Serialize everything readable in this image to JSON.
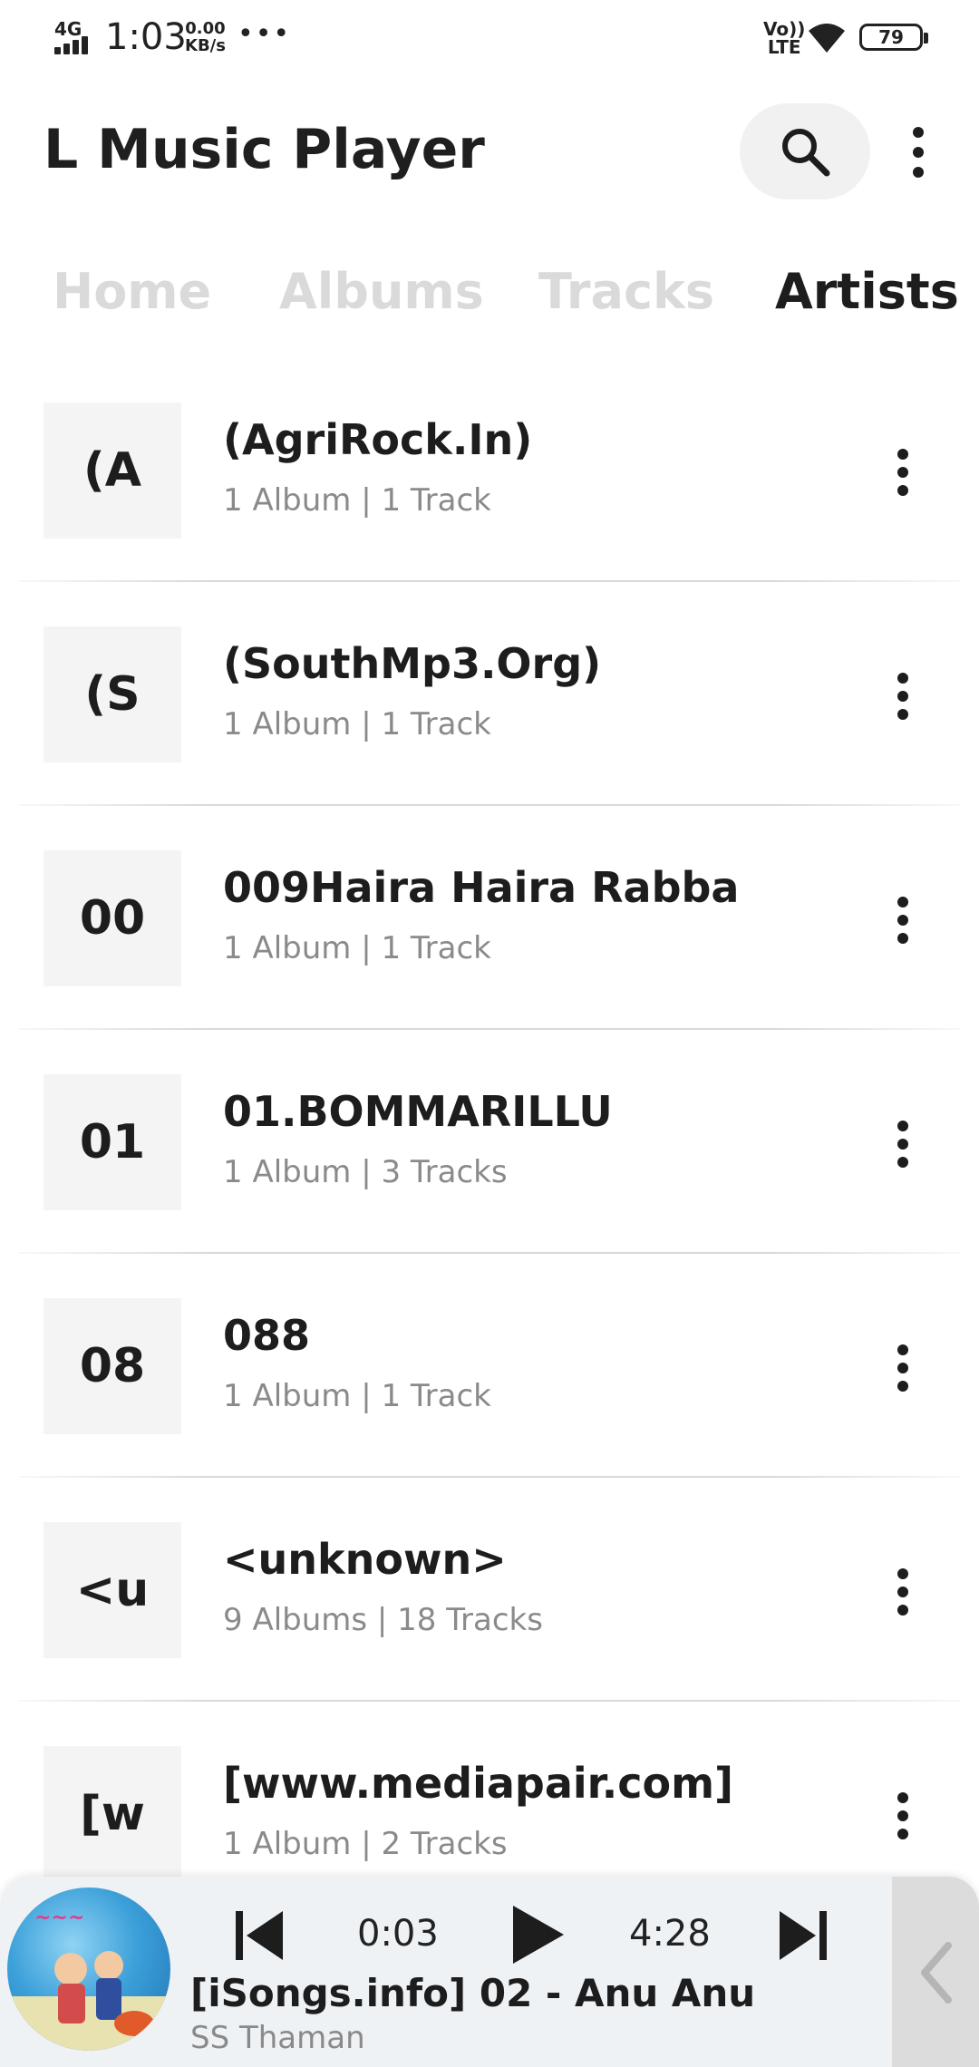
{
  "status_bar": {
    "network": "4G",
    "time": "1:03",
    "speed_value": "0.00",
    "speed_unit": "KB/s",
    "volte_top": "Vo))",
    "volte_bottom": "LTE",
    "battery": "79"
  },
  "app": {
    "title": "L Music Player"
  },
  "tabs": [
    {
      "label": "Home",
      "active": false
    },
    {
      "label": "Albums",
      "active": false
    },
    {
      "label": "Tracks",
      "active": false
    },
    {
      "label": "Artists",
      "active": true
    }
  ],
  "artists": [
    {
      "initials": "(A",
      "name": "(AgriRock.In)",
      "meta": "1 Album | 1 Track"
    },
    {
      "initials": "(S",
      "name": "(SouthMp3.Org)",
      "meta": "1 Album | 1 Track"
    },
    {
      "initials": "00",
      "name": "009Haira Haira Rabba",
      "meta": "1 Album | 1 Track"
    },
    {
      "initials": "01",
      "name": "01.BOMMARILLU",
      "meta": "1 Album | 3 Tracks"
    },
    {
      "initials": "08",
      "name": "088",
      "meta": "1 Album | 1 Track"
    },
    {
      "initials": "<u",
      "name": "<unknown>",
      "meta": "9 Albums | 18 Tracks"
    },
    {
      "initials": "[w",
      "name": "[www.mediapair.com]",
      "meta": "1 Album | 2 Tracks"
    }
  ],
  "now_playing": {
    "current_time": "0:03",
    "total_time": "4:28",
    "title": "[iSongs.info] 02 - Anu Anu",
    "artist": "SS Thaman"
  },
  "icons": {
    "search": "search-icon",
    "more": "more-vert-icon",
    "prev": "skip-previous-icon",
    "play": "play-icon",
    "next": "skip-next-icon",
    "collapse": "chevron-left-icon"
  },
  "colors": {
    "tab_inactive": "#dadada",
    "tab_active": "#1d1d1d",
    "thumb_bg": "#f4f4f4",
    "player_bg": "#eef2f5"
  }
}
